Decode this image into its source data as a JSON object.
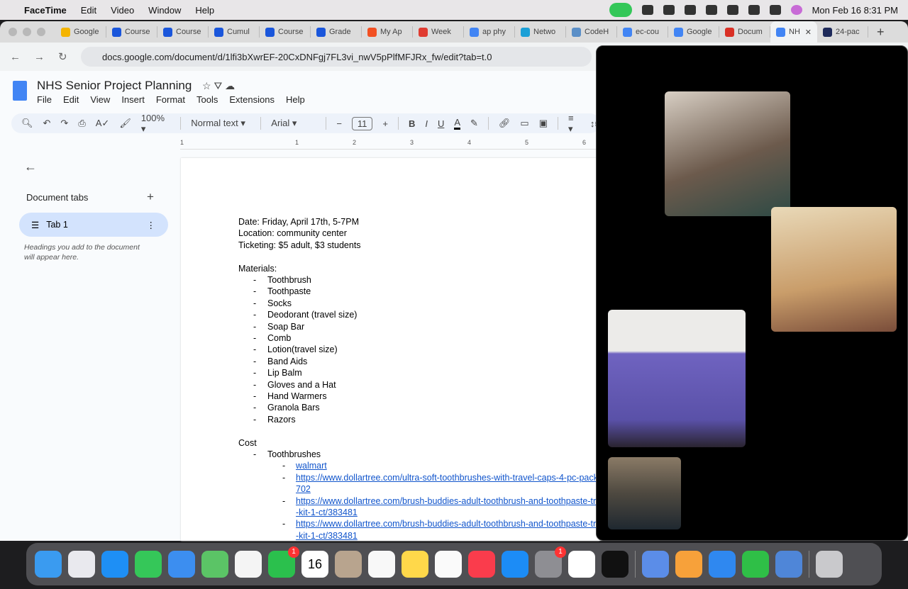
{
  "menubar": {
    "app": "FaceTime",
    "items": [
      "Edit",
      "Video",
      "Window",
      "Help"
    ],
    "datetime": "Mon Feb 16  8:31 PM"
  },
  "tabs": [
    {
      "label": "Google",
      "color": "#f4b400"
    },
    {
      "label": "Course",
      "color": "#1a56db"
    },
    {
      "label": "Course",
      "color": "#1a56db"
    },
    {
      "label": "Cumul",
      "color": "#1a56db"
    },
    {
      "label": "Course",
      "color": "#1a56db"
    },
    {
      "label": "Grade",
      "color": "#1a56db"
    },
    {
      "label": "My Ap",
      "color": "#f25022"
    },
    {
      "label": "Week",
      "color": "#e03c31"
    },
    {
      "label": "ap phy",
      "color": "#4285f4"
    },
    {
      "label": "Netwo",
      "color": "#1ba0d7"
    },
    {
      "label": "CodeH",
      "color": "#5b8fc7"
    },
    {
      "label": "ec-cou",
      "color": "#4285f4"
    },
    {
      "label": "Google",
      "color": "#4285f4"
    },
    {
      "label": "Docum",
      "color": "#d93025"
    },
    {
      "label": "NH",
      "color": "#4285f4",
      "active": true
    },
    {
      "label": "24-pac",
      "color": "#1e2a5a"
    }
  ],
  "address": {
    "url": "docs.google.com/document/d/1lfi3bXwrEF-20CxDNFgj7FL3vi_nwV5pPlfMFJRx_fw/edit?tab=t.0"
  },
  "doc": {
    "title": "NHS Senior Project Planning",
    "menus": [
      "File",
      "Edit",
      "View",
      "Insert",
      "Format",
      "Tools",
      "Extensions",
      "Help"
    ],
    "toolbar": {
      "zoom": "100%",
      "style": "Normal text",
      "font": "Arial",
      "size": "11"
    },
    "ruler": [
      "1",
      "1",
      "2",
      "3",
      "4",
      "5",
      "6"
    ]
  },
  "sidebar": {
    "heading": "Document tabs",
    "tab": "Tab 1",
    "hint": "Headings you add to the document will appear here."
  },
  "content": {
    "info": [
      "Date: Friday, April 17th, 5-7PM",
      "Location: community center",
      "Ticketing: $5 adult, $3 students"
    ],
    "materials_heading": "Materials:",
    "materials": [
      "Toothbrush",
      "Toothpaste",
      "Socks",
      "Deodorant (travel size)",
      "Soap Bar",
      "Comb",
      "Lotion(travel size)",
      "Band Aids",
      "Lip Balm",
      "Gloves and a Hat",
      "Hand Warmers",
      "Granola Bars",
      "Razors"
    ],
    "cost_heading": "Cost",
    "cost_item": "Toothbrushes",
    "links": [
      [
        "walmart"
      ],
      [
        "https://www.dollartree.com/ultra-soft-toothbrushes-with-travel-caps-4-pc-pack",
        "702"
      ],
      [
        "https://www.dollartree.com/brush-buddies-adult-toothbrush-and-toothpaste-tra",
        "-kit-1-ct/383481"
      ],
      [
        "https://www.dollartree.com/brush-buddies-adult-toothbrush-and-toothpaste-tra",
        "-kit-1-ct/383481"
      ]
    ],
    "dash": "-"
  },
  "dock": [
    {
      "name": "finder",
      "color": "#3a9bf0"
    },
    {
      "name": "launchpad",
      "color": "#e9e9ee"
    },
    {
      "name": "safari",
      "color": "#1e8ff5"
    },
    {
      "name": "messages",
      "color": "#35c759"
    },
    {
      "name": "mail",
      "color": "#3c8ef0"
    },
    {
      "name": "maps",
      "color": "#5bc466"
    },
    {
      "name": "photos",
      "color": "#f4f4f4"
    },
    {
      "name": "facetime",
      "color": "#2bc04d",
      "badge": "1"
    },
    {
      "name": "calendar",
      "color": "#ffffff",
      "text": "16"
    },
    {
      "name": "contacts",
      "color": "#b8a48e"
    },
    {
      "name": "reminders",
      "color": "#f8f8f8"
    },
    {
      "name": "notes",
      "color": "#ffd84a"
    },
    {
      "name": "freeform",
      "color": "#fafafa"
    },
    {
      "name": "music",
      "color": "#fa3c4c"
    },
    {
      "name": "app-store",
      "color": "#1c8cf6"
    },
    {
      "name": "system-settings",
      "color": "#8e8e93",
      "badge": "1"
    },
    {
      "name": "chrome",
      "color": "#ffffff"
    },
    {
      "name": "spotify",
      "color": "#111111"
    },
    {
      "name": "screen-time",
      "color": "#5b8de8"
    },
    {
      "name": "pages",
      "color": "#f7a13a"
    },
    {
      "name": "keynote",
      "color": "#2f88f0"
    },
    {
      "name": "numbers",
      "color": "#2fbf47"
    },
    {
      "name": "preview",
      "color": "#4f86d8"
    },
    {
      "name": "trash",
      "color": "#c9c9cc"
    }
  ]
}
